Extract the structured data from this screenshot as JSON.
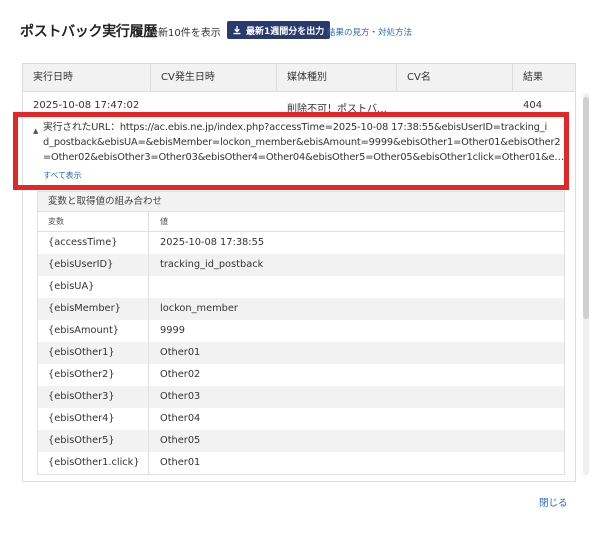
{
  "header": {
    "title": "ポストバック実行履歴",
    "subtitle": "最新10件を表示",
    "export_label": "最新1週間分を出力",
    "help_link": "結果の見方・対処方法"
  },
  "history_table": {
    "columns": [
      "実行日時",
      "CV発生日時",
      "媒体種別",
      "CV名",
      "結果"
    ],
    "row": {
      "executed_at": "2025-10-08 17:47:02",
      "cv_time": "",
      "media_type": "削除不可！ポストバ…",
      "cv_name": "",
      "result": "404"
    }
  },
  "url_detail": {
    "label": "実行されたURL：https://ac.ebis.ne.jp/index.php?accessTime=2025-10-08 17:38:55&ebisUserID=tracking_i",
    "line2": "d_postback&ebisUA=&ebisMember=lockon_member&ebisAmount=9999&ebisOther1=Other01&ebisOther2",
    "line3": "=Other02&ebisOther3=Other03&ebisOther4=Other04&ebisOther5=Other05&ebisOther1click=Other01&e…",
    "show_all": "すべて表示"
  },
  "variables": {
    "title": "変数と取得値の組み合わせ",
    "headers": [
      "変数",
      "値"
    ],
    "rows": [
      {
        "name": "{accessTime}",
        "value": "2025-10-08 17:38:55"
      },
      {
        "name": "{ebisUserID}",
        "value": "tracking_id_postback"
      },
      {
        "name": "{ebisUA}",
        "value": ""
      },
      {
        "name": "{ebisMember}",
        "value": "lockon_member"
      },
      {
        "name": "{ebisAmount}",
        "value": "9999"
      },
      {
        "name": "{ebisOther1}",
        "value": "Other01"
      },
      {
        "name": "{ebisOther2}",
        "value": "Other02"
      },
      {
        "name": "{ebisOther3}",
        "value": "Other03"
      },
      {
        "name": "{ebisOther4}",
        "value": "Other04"
      },
      {
        "name": "{ebisOther5}",
        "value": "Other05"
      },
      {
        "name": "{ebisOther1.click}",
        "value": "Other01"
      }
    ]
  },
  "footer": {
    "close_label": "閉じる"
  },
  "icons": {
    "export": "download-icon",
    "expand": "caret-up-icon"
  },
  "colors": {
    "highlight": "#e32626",
    "button": "#283a6e",
    "link": "#2966c9"
  }
}
